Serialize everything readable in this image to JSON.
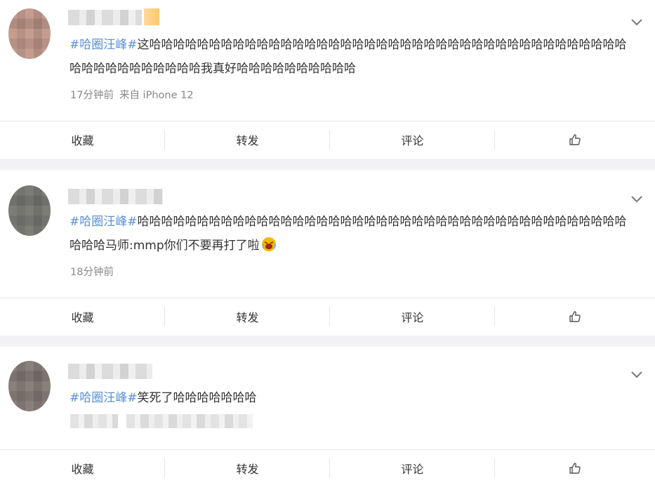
{
  "posts": [
    {
      "topic": "#哈圈汪峰#",
      "text": "这哈哈哈哈哈哈哈哈哈哈哈哈哈哈哈哈哈哈哈哈哈哈哈哈哈哈哈哈哈哈哈哈哈哈哈哈哈哈哈哈哈哈哈哈哈哈哈哈哈哈哈我真好哈哈哈哈哈哈哈哈哈哈",
      "time": "17分钟前",
      "source": "来自 iPhone 12",
      "emoji": ""
    },
    {
      "topic": "#哈圈汪峰#",
      "text": "哈哈哈哈哈哈哈哈哈哈哈哈哈哈哈哈哈哈哈哈哈哈哈哈哈哈哈哈哈哈哈哈哈哈哈哈哈哈哈哈哈哈哈哈马师:mmp你们不要再打了啦",
      "time": "18分钟前",
      "source": "",
      "emoji": "crying-laughing-face-icon"
    },
    {
      "topic": "#哈圈汪峰#",
      "text": "笑死了哈哈哈哈哈哈哈",
      "time": "",
      "source": "",
      "emoji": ""
    }
  ],
  "actions": {
    "favorite": "收藏",
    "repost": "转发",
    "comment": "评论",
    "like_icon": "thumbs-up-icon"
  },
  "colors": {
    "topic": "#5a8fd6",
    "meta": "#888888",
    "background": "#f2f2f5"
  }
}
